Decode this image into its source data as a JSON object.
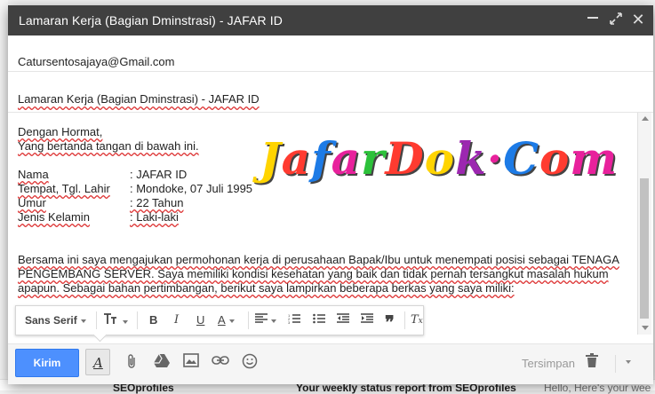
{
  "window": {
    "title": "Lamaran Kerja (Bagian Dminstrasi) - JAFAR ID"
  },
  "recipient": "Catursentosajaya@Gmail.com",
  "subject": "Lamaran Kerja (Bagian Dminstrasi) - JAFAR ID",
  "body": {
    "greeting": "Dengan Hormat,",
    "intro": "Yang bertanda tangan di bawah ini.",
    "fields": [
      {
        "label": "Nama",
        "value": ": JAFAR ID"
      },
      {
        "label": "Tempat, Tgl. Lahir",
        "value": ": Mondoke, 07 Juli 1995"
      },
      {
        "label": "Umur",
        "value": ": 22 Tahun"
      },
      {
        "label": "Jenis Kelamin",
        "value": ": Laki-laki"
      }
    ],
    "paragraph_line1": "Bersama ini saya mengajukan permohonan kerja di perusahaan Bapak/Ibu untuk menempati posisi sebagai TENAGA",
    "paragraph_line2": "PENGEMBANG SERVER. Saya memiliki kondisi kesehatan yang baik dan tidak pernah tersangkut masalah hukum",
    "paragraph_line3": "apapun. Sebagai bahan pertimbangan, berikut saya lampirkan beberapa berkas yang saya miliki:"
  },
  "watermark": {
    "text": "JafarDok·Com"
  },
  "format_toolbar": {
    "font": "Sans Serif",
    "size_icon": "text-size-icon",
    "bold": "B",
    "italic": "I",
    "underline": "U",
    "text_color": "A"
  },
  "bottom_bar": {
    "send_label": "Kirim",
    "saved_label": "Tersimpan"
  },
  "background": {
    "row_sender": "SEOprofiles",
    "row_subject": "Your weekly status report from SEOprofiles",
    "row_snippet": "Hello, Here's your wee"
  },
  "colors": {
    "titlebar": "#404040",
    "send_button": "#4d90fe"
  }
}
